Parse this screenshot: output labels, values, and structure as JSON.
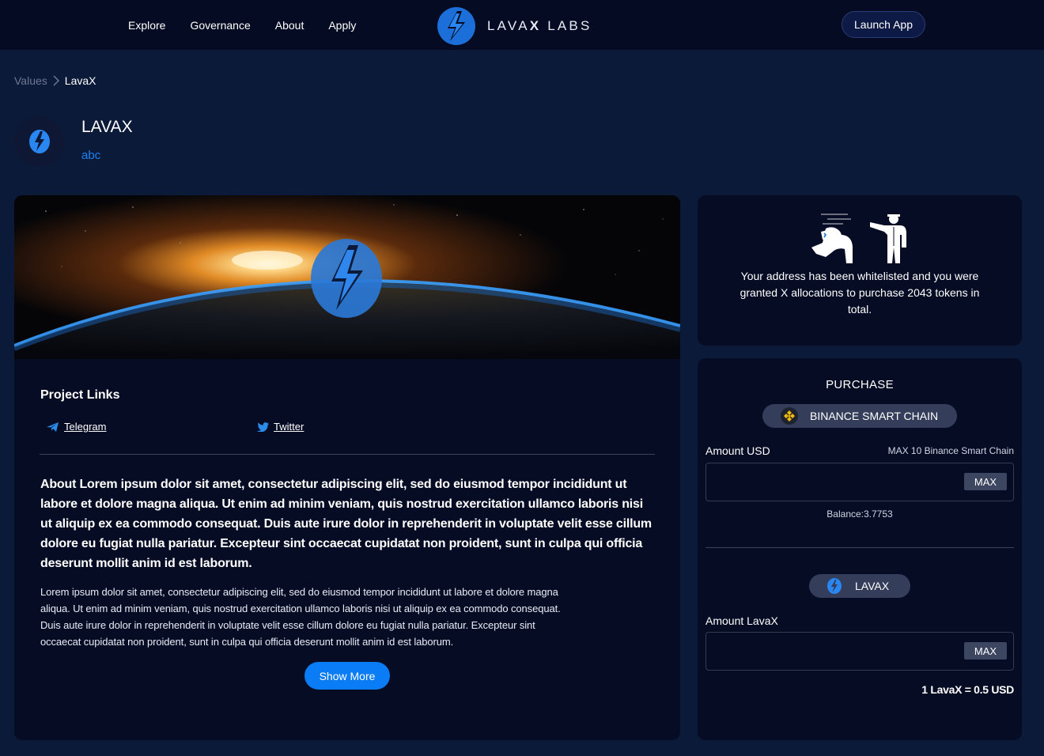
{
  "nav": {
    "links": [
      "Explore",
      "Governance",
      "About",
      "Apply"
    ],
    "brand_light": "LAVA",
    "brand_bold": "X",
    "brand_rest": " LABS",
    "launch_label": "Launch App"
  },
  "breadcrumb": {
    "root": "Values",
    "current": "LavaX"
  },
  "project": {
    "title": "LAVAX",
    "subtitle": "abc"
  },
  "links_section": {
    "title": "Project Links",
    "telegram": "Telegram",
    "twitter": "Twitter"
  },
  "about": {
    "bold": "About Lorem ipsum dolor sit amet, consectetur adipiscing elit, sed do eiusmod tempor incididunt ut labore et dolore magna aliqua. Ut enim ad minim veniam, quis nostrud exercitation ullamco laboris nisi ut aliquip ex ea commodo consequat. Duis aute irure dolor in reprehenderit in voluptate velit esse cillum dolore eu fugiat nulla pariatur. Excepteur sint occaecat cupidatat non proident, sunt in culpa qui officia deserunt mollit anim id est laborum.",
    "body": "Lorem ipsum dolor sit amet, consectetur adipiscing elit, sed do eiusmod tempor incididunt ut labore et dolore magna aliqua. Ut enim ad minim veniam, quis nostrud exercitation ullamco laboris nisi ut aliquip ex ea commodo consequat. Duis aute irure dolor in reprehenderit in voluptate velit esse cillum dolore eu fugiat nulla pariatur. Excepteur sint occaecat cupidatat non proident, sunt in culpa qui officia deserunt mollit anim id est laborum.",
    "show_more": "Show More"
  },
  "whitelist": {
    "message": "Your address has been whitelisted and you were granted X allocations to purchase 2043 tokens in total."
  },
  "purchase": {
    "title": "PURCHASE",
    "chain": "BINANCE SMART CHAIN",
    "amount_usd_label": "Amount USD",
    "amount_usd_hint": "MAX 10 Binance Smart Chain",
    "amount_usd_value": "",
    "max_label": "MAX",
    "balance": "Balance:3.7753",
    "token": "LAVAX",
    "amount_token_label": "Amount LavaX",
    "amount_token_value": "",
    "rate": "1 LavaX = 0.5 USD"
  },
  "colors": {
    "background": "#0b1a38",
    "nav": "#050b22",
    "card": "#060c24",
    "accent": "#0a7cf5",
    "link_blue": "#1e80f0",
    "pill": "#343e5a"
  },
  "icons": {
    "brand": "lavax-logo-icon",
    "telegram": "telegram-icon",
    "twitter": "twitter-icon",
    "bnb": "bnb-icon"
  }
}
